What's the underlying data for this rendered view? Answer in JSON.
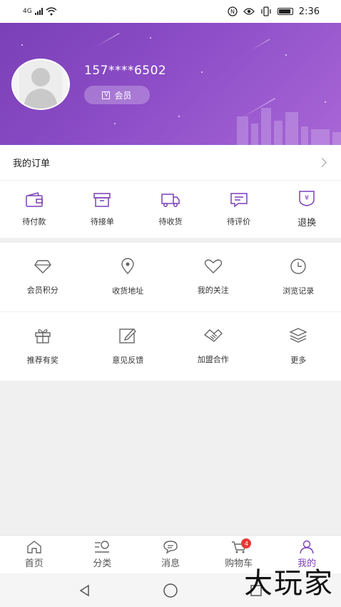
{
  "status_bar": {
    "network": "4G",
    "time": "2:36"
  },
  "profile": {
    "phone": "157****6502",
    "member_label": "会员"
  },
  "orders": {
    "title": "我的订单",
    "items": [
      {
        "label": "待付款",
        "icon": "wallet-icon"
      },
      {
        "label": "待接单",
        "icon": "box-icon"
      },
      {
        "label": "待收货",
        "icon": "truck-icon"
      },
      {
        "label": "待评价",
        "icon": "comment-icon"
      },
      {
        "label": "退换",
        "icon": "yen-shield-icon"
      }
    ]
  },
  "services": [
    {
      "label": "会员积分",
      "icon": "diamond-icon"
    },
    {
      "label": "收货地址",
      "icon": "location-pin-icon"
    },
    {
      "label": "我的关注",
      "icon": "heart-icon"
    },
    {
      "label": "浏览记录",
      "icon": "clock-icon"
    },
    {
      "label": "推荐有奖",
      "icon": "gift-icon"
    },
    {
      "label": "意见反馈",
      "icon": "edit-icon"
    },
    {
      "label": "加盟合作",
      "icon": "handshake-icon"
    },
    {
      "label": "更多",
      "icon": "layers-icon"
    }
  ],
  "tabbar": {
    "items": [
      {
        "label": "首页",
        "icon": "home-icon"
      },
      {
        "label": "分类",
        "icon": "category-icon"
      },
      {
        "label": "消息",
        "icon": "message-icon"
      },
      {
        "label": "购物车",
        "icon": "cart-icon",
        "badge": "4"
      },
      {
        "label": "我的",
        "icon": "user-icon"
      }
    ],
    "active_color": "#7b3fb8"
  },
  "watermark": "大玩家",
  "colors": {
    "header_gradient_start": "#7a3fb6",
    "header_gradient_end": "#a866d6",
    "accent": "#7b3fb8",
    "badge": "#e53935"
  }
}
